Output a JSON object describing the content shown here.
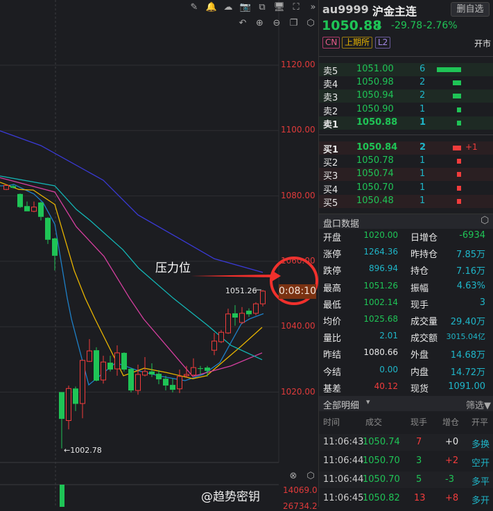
{
  "toolbar": {
    "icons_top": [
      "pencil-icon",
      "bell-icon",
      "cloud-icon",
      "camera-icon",
      "copy-icon",
      "monitor-icon",
      "fullscreen-icon",
      "collapse-icon"
    ],
    "icons_second": [
      "undo-icon",
      "zoom-in-icon",
      "zoom-out-icon",
      "layout-icon",
      "settings-icon"
    ]
  },
  "chart": {
    "axis_labels": [
      "1120.00",
      "1100.00",
      "1080.00",
      "1060.00",
      "1040.00",
      "1020.00"
    ],
    "high_label": "1051.26",
    "low_label": "1002.78",
    "timer": "0:08:10",
    "annotation": "压力位",
    "volume_labels": [
      "14069.0",
      "26734.2"
    ],
    "watermark": "@趋势密钥",
    "colors": {
      "up": "#f23c3c",
      "down": "#1fc456",
      "ma1": "#1e80c8",
      "ma2": "#e8b400",
      "ma3": "#d63fa0",
      "ma4": "#13b5b5",
      "ma5": "#3a3ad8"
    }
  },
  "chart_data": {
    "type": "candlestick",
    "ylim": [
      1000,
      1140
    ],
    "candles": [
      [
        1082,
        1083.2,
        1083.5,
        1081.8
      ],
      [
        1083,
        1082.5,
        1083.3,
        1082.3
      ],
      [
        1080.6,
        1076.6,
        1080.8,
        1076.3
      ],
      [
        1076.9,
        1075.3,
        1078.3,
        1075.3
      ],
      [
        1075.3,
        1076.6,
        1078.3,
        1075
      ],
      [
        1078,
        1073.6,
        1078.3,
        1072.5
      ],
      [
        1073.3,
        1066.6,
        1073.5,
        1065.3
      ],
      [
        1067,
        1061.7,
        1067.2,
        1057.2
      ],
      [
        1020,
        1011.8,
        1020,
        1002.78
      ],
      [
        1011.3,
        1021.1,
        1022,
        1008.6
      ],
      [
        1021.1,
        1016.4,
        1021.7,
        1014.2
      ],
      [
        1016.5,
        1029.7,
        1029.9,
        1012
      ],
      [
        1029.4,
        1032.6,
        1036.2,
        1029.2
      ],
      [
        1032.8,
        1023.5,
        1033.7,
        1023.3
      ],
      [
        1023.7,
        1029.2,
        1031.1,
        1022.6
      ],
      [
        1029,
        1026.9,
        1031.1,
        1026.3
      ],
      [
        1027.1,
        1032,
        1034.3,
        1025
      ],
      [
        1032,
        1026.9,
        1032.2,
        1026.3
      ],
      [
        1027.1,
        1020.5,
        1027.3,
        1019.9
      ],
      [
        1020.5,
        1025.4,
        1028.4,
        1019.2
      ],
      [
        1025.2,
        1026.3,
        1030.7,
        1024.8
      ],
      [
        1026.3,
        1025.4,
        1028.8,
        1024.6
      ],
      [
        1025.6,
        1023.9,
        1026.7,
        1022.4
      ],
      [
        1024.1,
        1022,
        1025,
        1020.5
      ],
      [
        1022.2,
        1020.7,
        1024.1,
        1019.9
      ],
      [
        1021,
        1024.8,
        1026.9,
        1019.7
      ],
      [
        1025,
        1025.4,
        1028,
        1024.4
      ],
      [
        1025.2,
        1027.5,
        1030.3,
        1025.2
      ],
      [
        1027.3,
        1027.1,
        1028,
        1025.4
      ],
      [
        1027.5,
        1026.5,
        1028,
        1024.8
      ],
      [
        1032.8,
        1035.6,
        1038.1,
        1031.3
      ],
      [
        1035.4,
        1038.3,
        1039,
        1035
      ],
      [
        1038.1,
        1043.9,
        1045.5,
        1037.8
      ],
      [
        1044.1,
        1042.8,
        1046.6,
        1040.3
      ],
      [
        1041.3,
        1044.1,
        1046,
        1040.8
      ],
      [
        1044.9,
        1043.8,
        1045.6,
        1043
      ],
      [
        1044.1,
        1047,
        1047.5,
        1043.5
      ],
      [
        1047,
        1050.88,
        1051.26,
        1046.2
      ]
    ],
    "ma": [
      {
        "color": "#1e80c8",
        "points": [
          [
            -0.9,
            1083.1
          ],
          [
            0.1,
            1083.1
          ],
          [
            1.1,
            1083.5
          ],
          [
            2.4,
            1082.2
          ],
          [
            4,
            1080.6
          ],
          [
            5.3,
            1078
          ],
          [
            7,
            1071.4
          ],
          [
            8.8,
            1048.7
          ],
          [
            9.4,
            1042.4
          ],
          [
            11.9,
            1022.2
          ],
          [
            15.8,
            1029
          ],
          [
            19.1,
            1026.5
          ],
          [
            22.4,
            1024.8
          ],
          [
            25.8,
            1023.5
          ],
          [
            28.4,
            1025.4
          ],
          [
            30.8,
            1029
          ],
          [
            33.9,
            1040.9
          ],
          [
            35.1,
            1042.4
          ],
          [
            37.1,
            1044
          ]
        ]
      },
      {
        "color": "#e8b400",
        "points": [
          [
            -0.9,
            1084.2
          ],
          [
            1.8,
            1082
          ],
          [
            3.9,
            1081.8
          ],
          [
            7,
            1077.4
          ],
          [
            9.8,
            1057.2
          ],
          [
            11.4,
            1048.7
          ],
          [
            12.8,
            1042.4
          ],
          [
            16.9,
            1025
          ],
          [
            19.9,
            1027.3
          ],
          [
            23.1,
            1026
          ],
          [
            26.9,
            1024.1
          ],
          [
            28.9,
            1025
          ],
          [
            33.8,
            1033.9
          ],
          [
            36.9,
            1039.8
          ]
        ]
      },
      {
        "color": "#d63fa0",
        "points": [
          [
            -0.9,
            1085.6
          ],
          [
            7,
            1081.2
          ],
          [
            10.1,
            1070.6
          ],
          [
            14.1,
            1061.5
          ],
          [
            17.8,
            1048.7
          ],
          [
            19.8,
            1042.4
          ],
          [
            26.9,
            1024.8
          ],
          [
            32.4,
            1028
          ],
          [
            36.9,
            1032
          ]
        ]
      },
      {
        "color": "#13b5b5",
        "points": [
          [
            -0.9,
            1086.1
          ],
          [
            7,
            1083.1
          ],
          [
            10.1,
            1075.9
          ],
          [
            12.1,
            1072.5
          ],
          [
            16.8,
            1063.6
          ],
          [
            19.1,
            1057.9
          ],
          [
            24.1,
            1048.7
          ],
          [
            29.1,
            1040.3
          ],
          [
            32.4,
            1034.3
          ],
          [
            36.9,
            1029.9
          ]
        ]
      },
      {
        "color": "#3a3ad8",
        "points": [
          [
            -1,
            1100
          ],
          [
            5,
            1095.4
          ],
          [
            14,
            1084.8
          ],
          [
            19,
            1074.2
          ],
          [
            26,
            1065.7
          ],
          [
            30,
            1060.8
          ],
          [
            37,
            1056.6
          ]
        ]
      }
    ]
  },
  "quote": {
    "symbol": "au9999",
    "name": "沪金主连",
    "fav_button": "删自选",
    "price": "1050.88",
    "change": "-29.78",
    "change_pct": "-2.76%",
    "tags": [
      "CN",
      "上期所",
      "L2"
    ],
    "status": "开市"
  },
  "asks": [
    {
      "label": "卖5",
      "price": "1051.00",
      "vol": "6",
      "bar": 6
    },
    {
      "label": "卖4",
      "price": "1050.98",
      "vol": "2",
      "bar": 2
    },
    {
      "label": "卖3",
      "price": "1050.94",
      "vol": "2",
      "bar": 2
    },
    {
      "label": "卖2",
      "price": "1050.90",
      "vol": "1",
      "bar": 1
    },
    {
      "label": "卖1",
      "price": "1050.88",
      "vol": "1",
      "bar": 1
    }
  ],
  "bids": [
    {
      "label": "买1",
      "price": "1050.84",
      "vol": "2",
      "bar": 2,
      "delta": "+1"
    },
    {
      "label": "买2",
      "price": "1050.78",
      "vol": "1",
      "bar": 1,
      "delta": ""
    },
    {
      "label": "买3",
      "price": "1050.74",
      "vol": "1",
      "bar": 1,
      "delta": ""
    },
    {
      "label": "买4",
      "price": "1050.70",
      "vol": "1",
      "bar": 1,
      "delta": ""
    },
    {
      "label": "买5",
      "price": "1050.48",
      "vol": "1",
      "bar": 1,
      "delta": ""
    }
  ],
  "stats": {
    "title": "盘口数据",
    "rows": [
      [
        "开盘",
        "1020.00",
        "g",
        "日增仓",
        "-6934",
        "g"
      ],
      [
        "涨停",
        "1264.36",
        "c",
        "昨持仓",
        "7.85万",
        "c"
      ],
      [
        "跌停",
        "896.94",
        "c",
        "持仓",
        "7.16万",
        "c"
      ],
      [
        "最高",
        "1051.26",
        "g",
        "振幅",
        "4.63%",
        "c"
      ],
      [
        "最低",
        "1002.14",
        "g",
        "现手",
        "3",
        "c"
      ],
      [
        "均价",
        "1025.68",
        "g",
        "成交量",
        "29.40万",
        "c"
      ],
      [
        "量比",
        "2.01",
        "c",
        "成交额",
        "3015.04亿",
        "c"
      ],
      [
        "昨结",
        "1080.66",
        "w",
        "外盘",
        "14.68万",
        "c"
      ],
      [
        "今结",
        "0.00",
        "c",
        "内盘",
        "14.72万",
        "c"
      ],
      [
        "基差",
        "40.12",
        "r",
        "现货",
        "1091.00",
        "c"
      ]
    ]
  },
  "trades": {
    "title": "全部明细",
    "filter": "筛选",
    "headers": [
      "时间",
      "成交",
      "现手",
      "增仓",
      "开平"
    ],
    "rows": [
      [
        "11:06:43",
        "1050.74",
        "7",
        "r",
        "+0",
        "w",
        "多换"
      ],
      [
        "11:06:44",
        "1050.70",
        "3",
        "g",
        "+2",
        "r",
        "空开"
      ],
      [
        "11:06:44",
        "1050.70",
        "5",
        "g",
        "-3",
        "g",
        "多平"
      ],
      [
        "11:06:45",
        "1050.82",
        "13",
        "r",
        "+8",
        "r",
        "多开"
      ]
    ]
  }
}
